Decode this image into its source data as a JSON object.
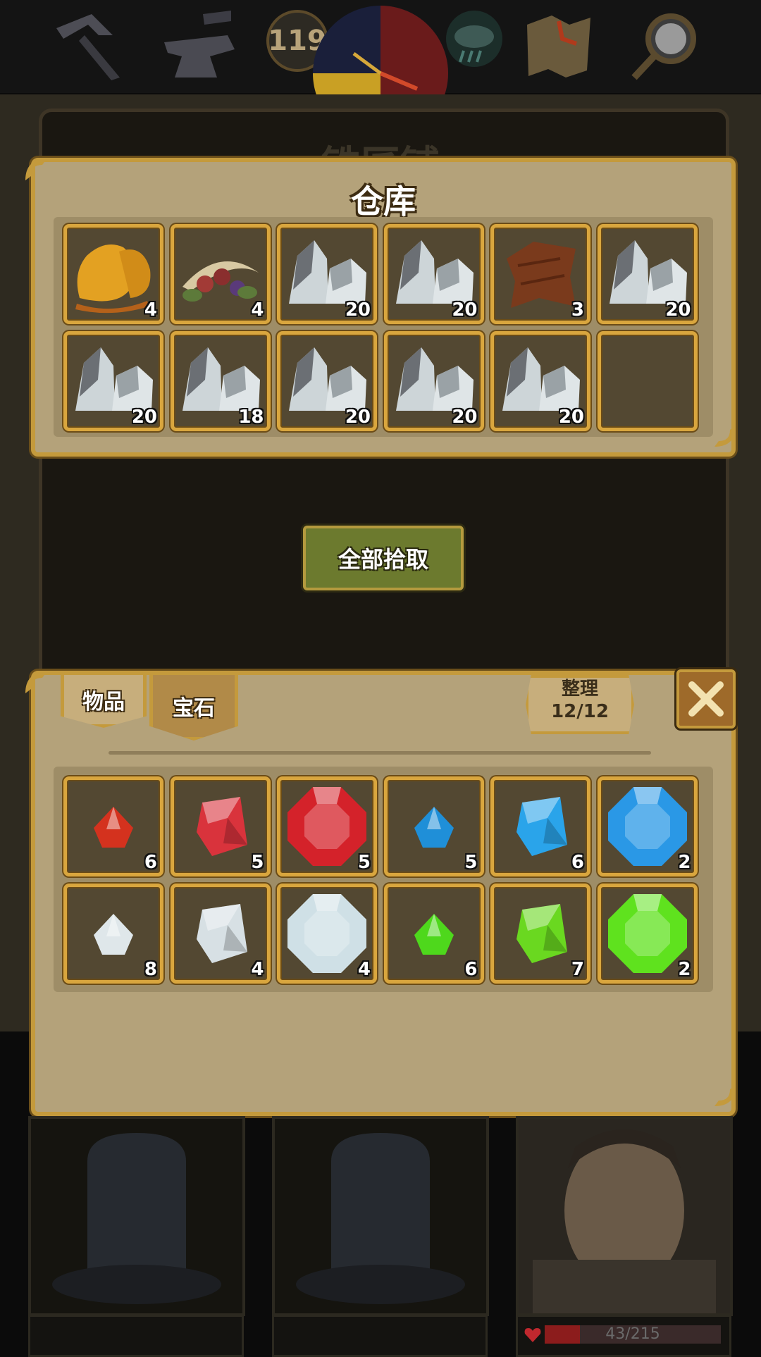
{
  "hud": {
    "day_count": "119",
    "icons": [
      "pickaxe-icon",
      "anvil-icon",
      "day-night-clock-icon",
      "weather-storm-icon",
      "treasure-map-icon",
      "magnifier-icon"
    ]
  },
  "scene": {
    "title": "铁匠铺"
  },
  "warehouse": {
    "title": "仓库",
    "items": [
      {
        "icon": "honeycomb-icon",
        "qty": "4"
      },
      {
        "icon": "herbs-icon",
        "qty": "4"
      },
      {
        "icon": "iron-ore-icon",
        "qty": "20"
      },
      {
        "icon": "iron-ore-icon",
        "qty": "20"
      },
      {
        "icon": "leather-hide-icon",
        "qty": "3"
      },
      {
        "icon": "iron-ore-icon",
        "qty": "20"
      },
      {
        "icon": "iron-ore-icon",
        "qty": "20"
      },
      {
        "icon": "iron-ore-icon",
        "qty": "18"
      },
      {
        "icon": "iron-ore-icon",
        "qty": "20"
      },
      {
        "icon": "iron-ore-icon",
        "qty": "20"
      },
      {
        "icon": "iron-ore-icon",
        "qty": "20"
      },
      {
        "icon": "",
        "qty": ""
      }
    ]
  },
  "collect_all_label": "全部拾取",
  "inventory": {
    "tabs": [
      {
        "label": "物品",
        "active": false
      },
      {
        "label": "宝石",
        "active": true
      }
    ],
    "sort": {
      "label": "整理",
      "count": "12/12"
    },
    "gems": [
      {
        "icon": "red-gem-small-icon",
        "color": "#d4321e",
        "qty": "6"
      },
      {
        "icon": "red-gem-medium-icon",
        "color": "#d9333c",
        "qty": "5"
      },
      {
        "icon": "red-gem-large-icon",
        "color": "#d4222a",
        "qty": "5"
      },
      {
        "icon": "blue-gem-small-icon",
        "color": "#1f8fd8",
        "qty": "5"
      },
      {
        "icon": "blue-gem-medium-icon",
        "color": "#2aa4ea",
        "qty": "6"
      },
      {
        "icon": "blue-gem-large-icon",
        "color": "#2a98e6",
        "qty": "2"
      },
      {
        "icon": "white-gem-small-icon",
        "color": "#dfe7ea",
        "qty": "8"
      },
      {
        "icon": "white-gem-medium-icon",
        "color": "#d7e0e4",
        "qty": "4"
      },
      {
        "icon": "white-gem-large-icon",
        "color": "#cfe0e6",
        "qty": "4"
      },
      {
        "icon": "green-gem-small-icon",
        "color": "#4ed81c",
        "qty": "6"
      },
      {
        "icon": "green-gem-medium-icon",
        "color": "#6ad820",
        "qty": "7"
      },
      {
        "icon": "green-gem-large-icon",
        "color": "#5fe21e",
        "qty": "2"
      }
    ]
  },
  "hero": {
    "hp": "43/215"
  }
}
